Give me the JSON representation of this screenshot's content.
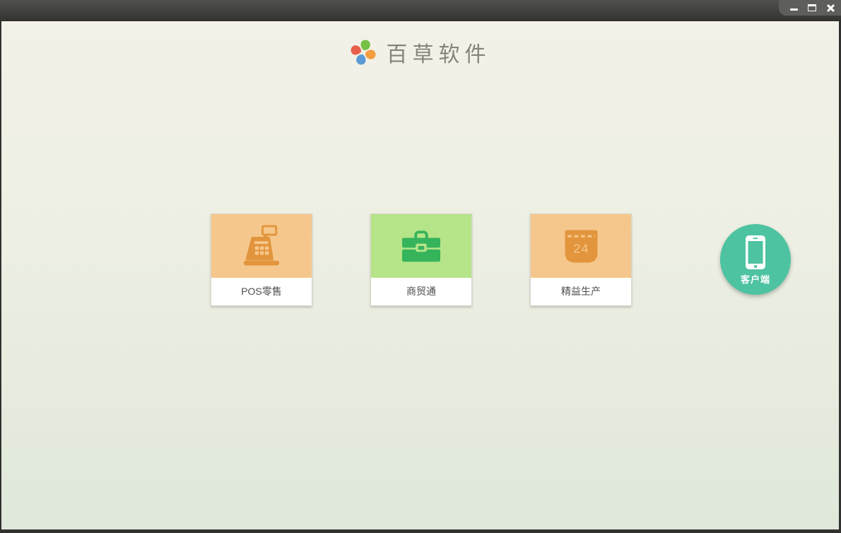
{
  "window": {
    "controls": [
      {
        "name": "minimize"
      },
      {
        "name": "maximize"
      },
      {
        "name": "close"
      }
    ]
  },
  "header": {
    "app_name": "百草软件"
  },
  "colors": {
    "titlebar_top": "#4f4f4d",
    "titlebar_bottom": "#343432",
    "content_top": "#f3f1e8",
    "content_bottom": "#dfe8da",
    "logo_petals": [
      "#76c043",
      "#f49d3f",
      "#5b9bd5",
      "#e8604c"
    ]
  },
  "products": [
    {
      "label": "POS零售",
      "icon": "cash-register-icon",
      "tile_bg": "#f6c78c",
      "icon_color": "#e2953c"
    },
    {
      "label": "商贸通",
      "icon": "briefcase-icon",
      "tile_bg": "#b5e489",
      "icon_color": "#36b45c"
    },
    {
      "label": "精益生产",
      "icon": "calendar-icon",
      "tile_bg": "#f6c78c",
      "icon_color": "#e2953c",
      "day": "24"
    }
  ],
  "client": {
    "label": "客户端",
    "icon": "smartphone-icon",
    "bg": "#4dc3a1"
  }
}
